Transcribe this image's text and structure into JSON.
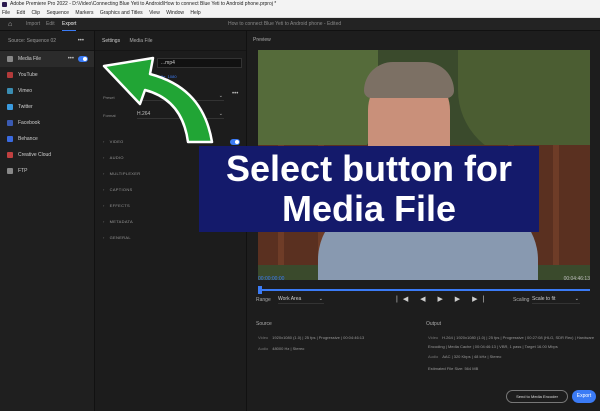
{
  "window": {
    "title": "Adobe Premiere Pro 2022 - D:\\Video\\Connecting Blue Yeti to Android\\How to connect Blue Yeti to Android phone.prproj *"
  },
  "menu": [
    "File",
    "Edit",
    "Clip",
    "Sequence",
    "Markers",
    "Graphics and Titles",
    "View",
    "Window",
    "Help"
  ],
  "header": {
    "tabs": [
      "Import",
      "Edit",
      "Export"
    ],
    "active_tab": "Export",
    "project_title": "How to connect Blue Yeti to Android phone - Edited"
  },
  "sidebar": {
    "source_label": "Source: Sequence 02",
    "destinations": [
      {
        "label": "Media File",
        "icon": "media-file-icon",
        "color": "#888888",
        "active": true
      },
      {
        "label": "YouTube",
        "icon": "youtube-icon",
        "color": "#b23a3a"
      },
      {
        "label": "Vimeo",
        "icon": "vimeo-icon",
        "color": "#3a8db2"
      },
      {
        "label": "Twitter",
        "icon": "twitter-icon",
        "color": "#3a9be0"
      },
      {
        "label": "Facebook",
        "icon": "facebook-icon",
        "color": "#3a5ab2"
      },
      {
        "label": "Behance",
        "icon": "behance-icon",
        "color": "#3a6ae0"
      },
      {
        "label": "Creative Cloud",
        "icon": "creative-cloud-icon",
        "color": "#c04040"
      },
      {
        "label": "FTP",
        "icon": "ftp-icon",
        "color": "#888888"
      }
    ]
  },
  "settings": {
    "header": "Settings",
    "subheader": "Media File",
    "file_name": "...mp4",
    "location": "...file_1080",
    "preset_label": "Preset",
    "format_label": "Format",
    "format_value": "H.264",
    "sections": [
      "VIDEO",
      "AUDIO",
      "MULTIPLEXER",
      "CAPTIONS",
      "EFFECTS",
      "METADATA",
      "GENERAL"
    ]
  },
  "preview": {
    "label": "Preview",
    "timecode_start": "00:00:00:00",
    "timecode_end": "00:04:46:13",
    "playhead_fraction": 0.0,
    "range_label": "Range",
    "range_value": "Work Area",
    "scaling_label": "Scaling",
    "scaling_value": "Scale to fit",
    "controls": "|◀ ◀ ▶ ▶ ▶|"
  },
  "summary": {
    "source_title": "Source",
    "source_rows": [
      {
        "key": "Video",
        "value": "1920x1080 (1.0) | 25 fps | Progressive | 00:04:46:13"
      },
      {
        "key": "Audio",
        "value": "48000 Hz | Stereo"
      }
    ],
    "output_title": "Output",
    "output_rows": [
      {
        "key": "Video",
        "value": "H.264 | 1920x1080 (1.0) | 25 fps | Progressive | 00:27:08 (HLG, SDR Rec) | Hardware"
      },
      {
        "key": "",
        "value": "Encoding | Media Cache | 00:04:46:13 | VBR, 1 pass | Target 16.00 Mbps"
      },
      {
        "key": "Audio",
        "value": "AAC | 320 Kbps | 48 kHz | Stereo"
      },
      {
        "key": "",
        "value": "Estimated File Size: 564 MB"
      }
    ]
  },
  "footer": {
    "send_label": "Send to Media Encoder",
    "export_label": "Export"
  },
  "overlay": {
    "line1": "Select button for",
    "line2": "Media File"
  },
  "colors": {
    "accent": "#3b7bf5",
    "overlay_bg": "#141a6b",
    "arrow": "#21a535"
  }
}
